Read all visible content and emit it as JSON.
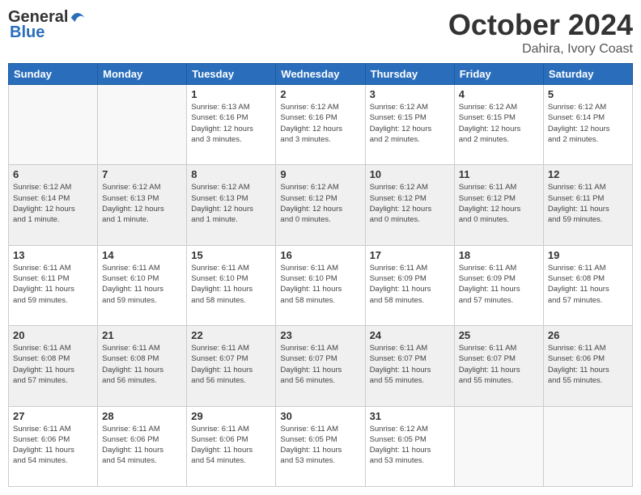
{
  "logo": {
    "general": "General",
    "blue": "Blue"
  },
  "header": {
    "title": "October 2024",
    "subtitle": "Dahira, Ivory Coast"
  },
  "days_of_week": [
    "Sunday",
    "Monday",
    "Tuesday",
    "Wednesday",
    "Thursday",
    "Friday",
    "Saturday"
  ],
  "weeks": [
    [
      {
        "day": "",
        "info": ""
      },
      {
        "day": "",
        "info": ""
      },
      {
        "day": "1",
        "info": "Sunrise: 6:13 AM\nSunset: 6:16 PM\nDaylight: 12 hours\nand 3 minutes."
      },
      {
        "day": "2",
        "info": "Sunrise: 6:12 AM\nSunset: 6:16 PM\nDaylight: 12 hours\nand 3 minutes."
      },
      {
        "day": "3",
        "info": "Sunrise: 6:12 AM\nSunset: 6:15 PM\nDaylight: 12 hours\nand 2 minutes."
      },
      {
        "day": "4",
        "info": "Sunrise: 6:12 AM\nSunset: 6:15 PM\nDaylight: 12 hours\nand 2 minutes."
      },
      {
        "day": "5",
        "info": "Sunrise: 6:12 AM\nSunset: 6:14 PM\nDaylight: 12 hours\nand 2 minutes."
      }
    ],
    [
      {
        "day": "6",
        "info": "Sunrise: 6:12 AM\nSunset: 6:14 PM\nDaylight: 12 hours\nand 1 minute."
      },
      {
        "day": "7",
        "info": "Sunrise: 6:12 AM\nSunset: 6:13 PM\nDaylight: 12 hours\nand 1 minute."
      },
      {
        "day": "8",
        "info": "Sunrise: 6:12 AM\nSunset: 6:13 PM\nDaylight: 12 hours\nand 1 minute."
      },
      {
        "day": "9",
        "info": "Sunrise: 6:12 AM\nSunset: 6:12 PM\nDaylight: 12 hours\nand 0 minutes."
      },
      {
        "day": "10",
        "info": "Sunrise: 6:12 AM\nSunset: 6:12 PM\nDaylight: 12 hours\nand 0 minutes."
      },
      {
        "day": "11",
        "info": "Sunrise: 6:11 AM\nSunset: 6:12 PM\nDaylight: 12 hours\nand 0 minutes."
      },
      {
        "day": "12",
        "info": "Sunrise: 6:11 AM\nSunset: 6:11 PM\nDaylight: 11 hours\nand 59 minutes."
      }
    ],
    [
      {
        "day": "13",
        "info": "Sunrise: 6:11 AM\nSunset: 6:11 PM\nDaylight: 11 hours\nand 59 minutes."
      },
      {
        "day": "14",
        "info": "Sunrise: 6:11 AM\nSunset: 6:10 PM\nDaylight: 11 hours\nand 59 minutes."
      },
      {
        "day": "15",
        "info": "Sunrise: 6:11 AM\nSunset: 6:10 PM\nDaylight: 11 hours\nand 58 minutes."
      },
      {
        "day": "16",
        "info": "Sunrise: 6:11 AM\nSunset: 6:10 PM\nDaylight: 11 hours\nand 58 minutes."
      },
      {
        "day": "17",
        "info": "Sunrise: 6:11 AM\nSunset: 6:09 PM\nDaylight: 11 hours\nand 58 minutes."
      },
      {
        "day": "18",
        "info": "Sunrise: 6:11 AM\nSunset: 6:09 PM\nDaylight: 11 hours\nand 57 minutes."
      },
      {
        "day": "19",
        "info": "Sunrise: 6:11 AM\nSunset: 6:08 PM\nDaylight: 11 hours\nand 57 minutes."
      }
    ],
    [
      {
        "day": "20",
        "info": "Sunrise: 6:11 AM\nSunset: 6:08 PM\nDaylight: 11 hours\nand 57 minutes."
      },
      {
        "day": "21",
        "info": "Sunrise: 6:11 AM\nSunset: 6:08 PM\nDaylight: 11 hours\nand 56 minutes."
      },
      {
        "day": "22",
        "info": "Sunrise: 6:11 AM\nSunset: 6:07 PM\nDaylight: 11 hours\nand 56 minutes."
      },
      {
        "day": "23",
        "info": "Sunrise: 6:11 AM\nSunset: 6:07 PM\nDaylight: 11 hours\nand 56 minutes."
      },
      {
        "day": "24",
        "info": "Sunrise: 6:11 AM\nSunset: 6:07 PM\nDaylight: 11 hours\nand 55 minutes."
      },
      {
        "day": "25",
        "info": "Sunrise: 6:11 AM\nSunset: 6:07 PM\nDaylight: 11 hours\nand 55 minutes."
      },
      {
        "day": "26",
        "info": "Sunrise: 6:11 AM\nSunset: 6:06 PM\nDaylight: 11 hours\nand 55 minutes."
      }
    ],
    [
      {
        "day": "27",
        "info": "Sunrise: 6:11 AM\nSunset: 6:06 PM\nDaylight: 11 hours\nand 54 minutes."
      },
      {
        "day": "28",
        "info": "Sunrise: 6:11 AM\nSunset: 6:06 PM\nDaylight: 11 hours\nand 54 minutes."
      },
      {
        "day": "29",
        "info": "Sunrise: 6:11 AM\nSunset: 6:06 PM\nDaylight: 11 hours\nand 54 minutes."
      },
      {
        "day": "30",
        "info": "Sunrise: 6:11 AM\nSunset: 6:05 PM\nDaylight: 11 hours\nand 53 minutes."
      },
      {
        "day": "31",
        "info": "Sunrise: 6:12 AM\nSunset: 6:05 PM\nDaylight: 11 hours\nand 53 minutes."
      },
      {
        "day": "",
        "info": ""
      },
      {
        "day": "",
        "info": ""
      }
    ]
  ]
}
